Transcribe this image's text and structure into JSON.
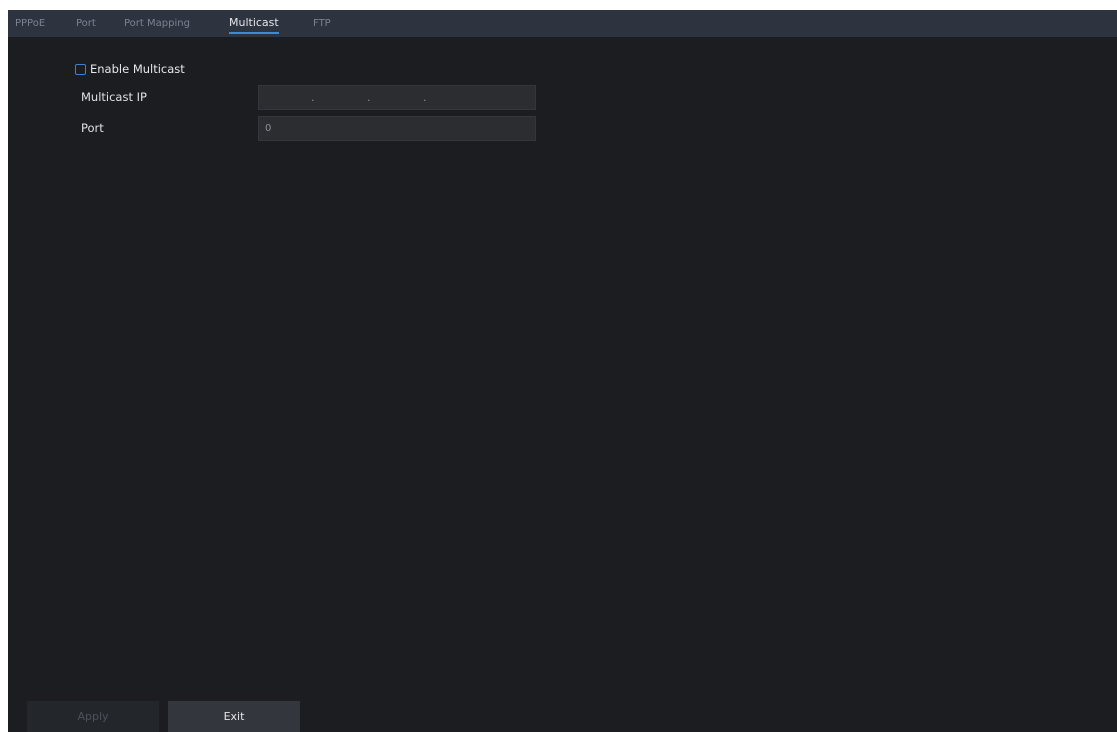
{
  "tabs": [
    {
      "label": "PPPoE",
      "active": false
    },
    {
      "label": "Port",
      "active": false
    },
    {
      "label": "Port Mapping",
      "active": false
    },
    {
      "label": "Multicast",
      "active": true
    },
    {
      "label": "FTP",
      "active": false
    }
  ],
  "multicast": {
    "enable_label": "Enable Multicast",
    "enabled": false,
    "ip_label": "Multicast IP",
    "ip_dots": [
      ".",
      ".",
      "."
    ],
    "port_label": "Port",
    "port_value": "0"
  },
  "buttons": {
    "apply_label": "Apply",
    "exit_label": "Exit"
  },
  "colors": {
    "background": "#1b1d20",
    "tab_bar": "#2e3340",
    "accent": "#3b82d6"
  }
}
